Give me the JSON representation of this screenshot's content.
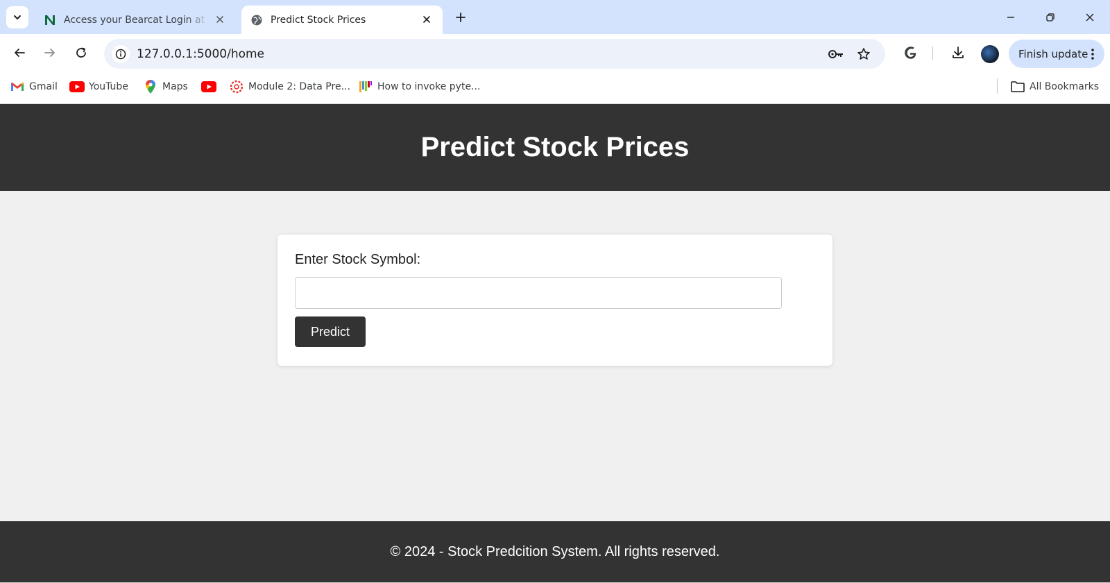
{
  "browser": {
    "tabs": [
      {
        "title": "Access your Bearcat Login at No",
        "active": false,
        "favicon": "n-logo-icon"
      },
      {
        "title": "Predict Stock Prices",
        "active": true,
        "favicon": "globe-icon"
      }
    ],
    "url": "127.0.0.1:5000/home",
    "finish_update_label": "Finish update",
    "bookmarks": [
      {
        "label": "Gmail",
        "icon": "gmail-icon"
      },
      {
        "label": "YouTube",
        "icon": "youtube-icon"
      },
      {
        "label": "Maps",
        "icon": "maps-icon"
      },
      {
        "label": "",
        "icon": "youtube-icon"
      },
      {
        "label": "Module 2: Data Pre...",
        "icon": "canvas-icon"
      },
      {
        "label": "How to invoke pyte...",
        "icon": "bars-icon"
      }
    ],
    "all_bookmarks_label": "All Bookmarks"
  },
  "page": {
    "header_title": "Predict Stock Prices",
    "form": {
      "label": "Enter Stock Symbol:",
      "input_value": "",
      "button_label": "Predict"
    },
    "footer_text": "© 2024 - Stock Predcition System. All rights reserved."
  },
  "colors": {
    "header_bg": "#333333",
    "page_bg": "#f0f0f0",
    "tabstrip_bg": "#d3e3fd",
    "omnibox_bg": "#edf2fa"
  }
}
